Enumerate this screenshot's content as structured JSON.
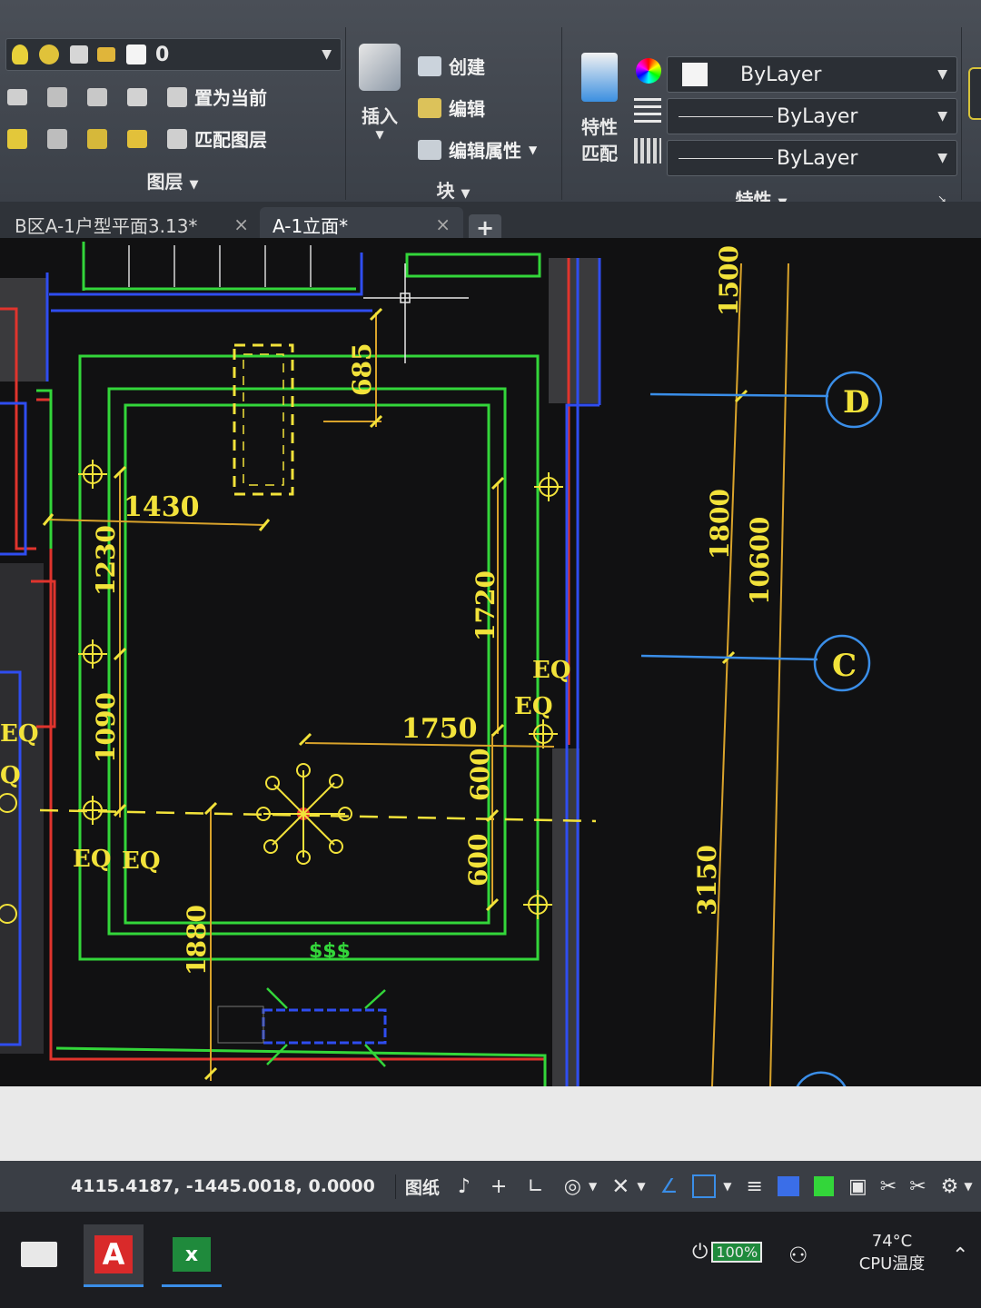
{
  "ribbon": {
    "layers_panel": {
      "layer_current": "0",
      "set_current": "置为当前",
      "match_layer": "匹配图层",
      "title": "图层"
    },
    "block_panel": {
      "insert": "插入",
      "create": "创建",
      "edit": "编辑",
      "edit_attributes": "编辑属性",
      "title": "块"
    },
    "properties_panel": {
      "match_properties_line1": "特性",
      "match_properties_line2": "匹配",
      "color": "ByLayer",
      "linetype": "ByLayer",
      "lineweight": "ByLayer",
      "title": "特性"
    }
  },
  "tabs": [
    {
      "label": "B区A-1户型平面3.13*",
      "close": "×"
    },
    {
      "label": "A-1立面*",
      "close": "×"
    }
  ],
  "new_tab": "+",
  "drawing": {
    "dims": {
      "d685": "685",
      "d1430": "1430",
      "d1230": "1230",
      "d1720": "1720",
      "d1090": "1090",
      "d1750": "1750",
      "d600a": "600",
      "d600b": "600",
      "d1880": "1880",
      "d1500": "1500",
      "d1800": "1800",
      "d10600": "10600",
      "d3150": "3150",
      "eq1": "EQ",
      "eq2": "EQ",
      "eq3": "EQ",
      "eq4": "EQ",
      "eq5": "EQ",
      "eq6": "Q"
    },
    "grid_d": "D",
    "grid_c": "C"
  },
  "statusbar": {
    "coords": "4115.4187, -1445.0018, 0.0000",
    "paper": "图纸"
  },
  "taskbar": {
    "battery": "100%",
    "temp": "74°C",
    "temp_label": "CPU温度"
  },
  "colors": {
    "green": "#33d63a",
    "yellow": "#f2e23a",
    "orange": "#d9a32b",
    "blue": "#2f4df0",
    "red": "#e0342d",
    "cyan_blue": "#3a8ee8"
  }
}
